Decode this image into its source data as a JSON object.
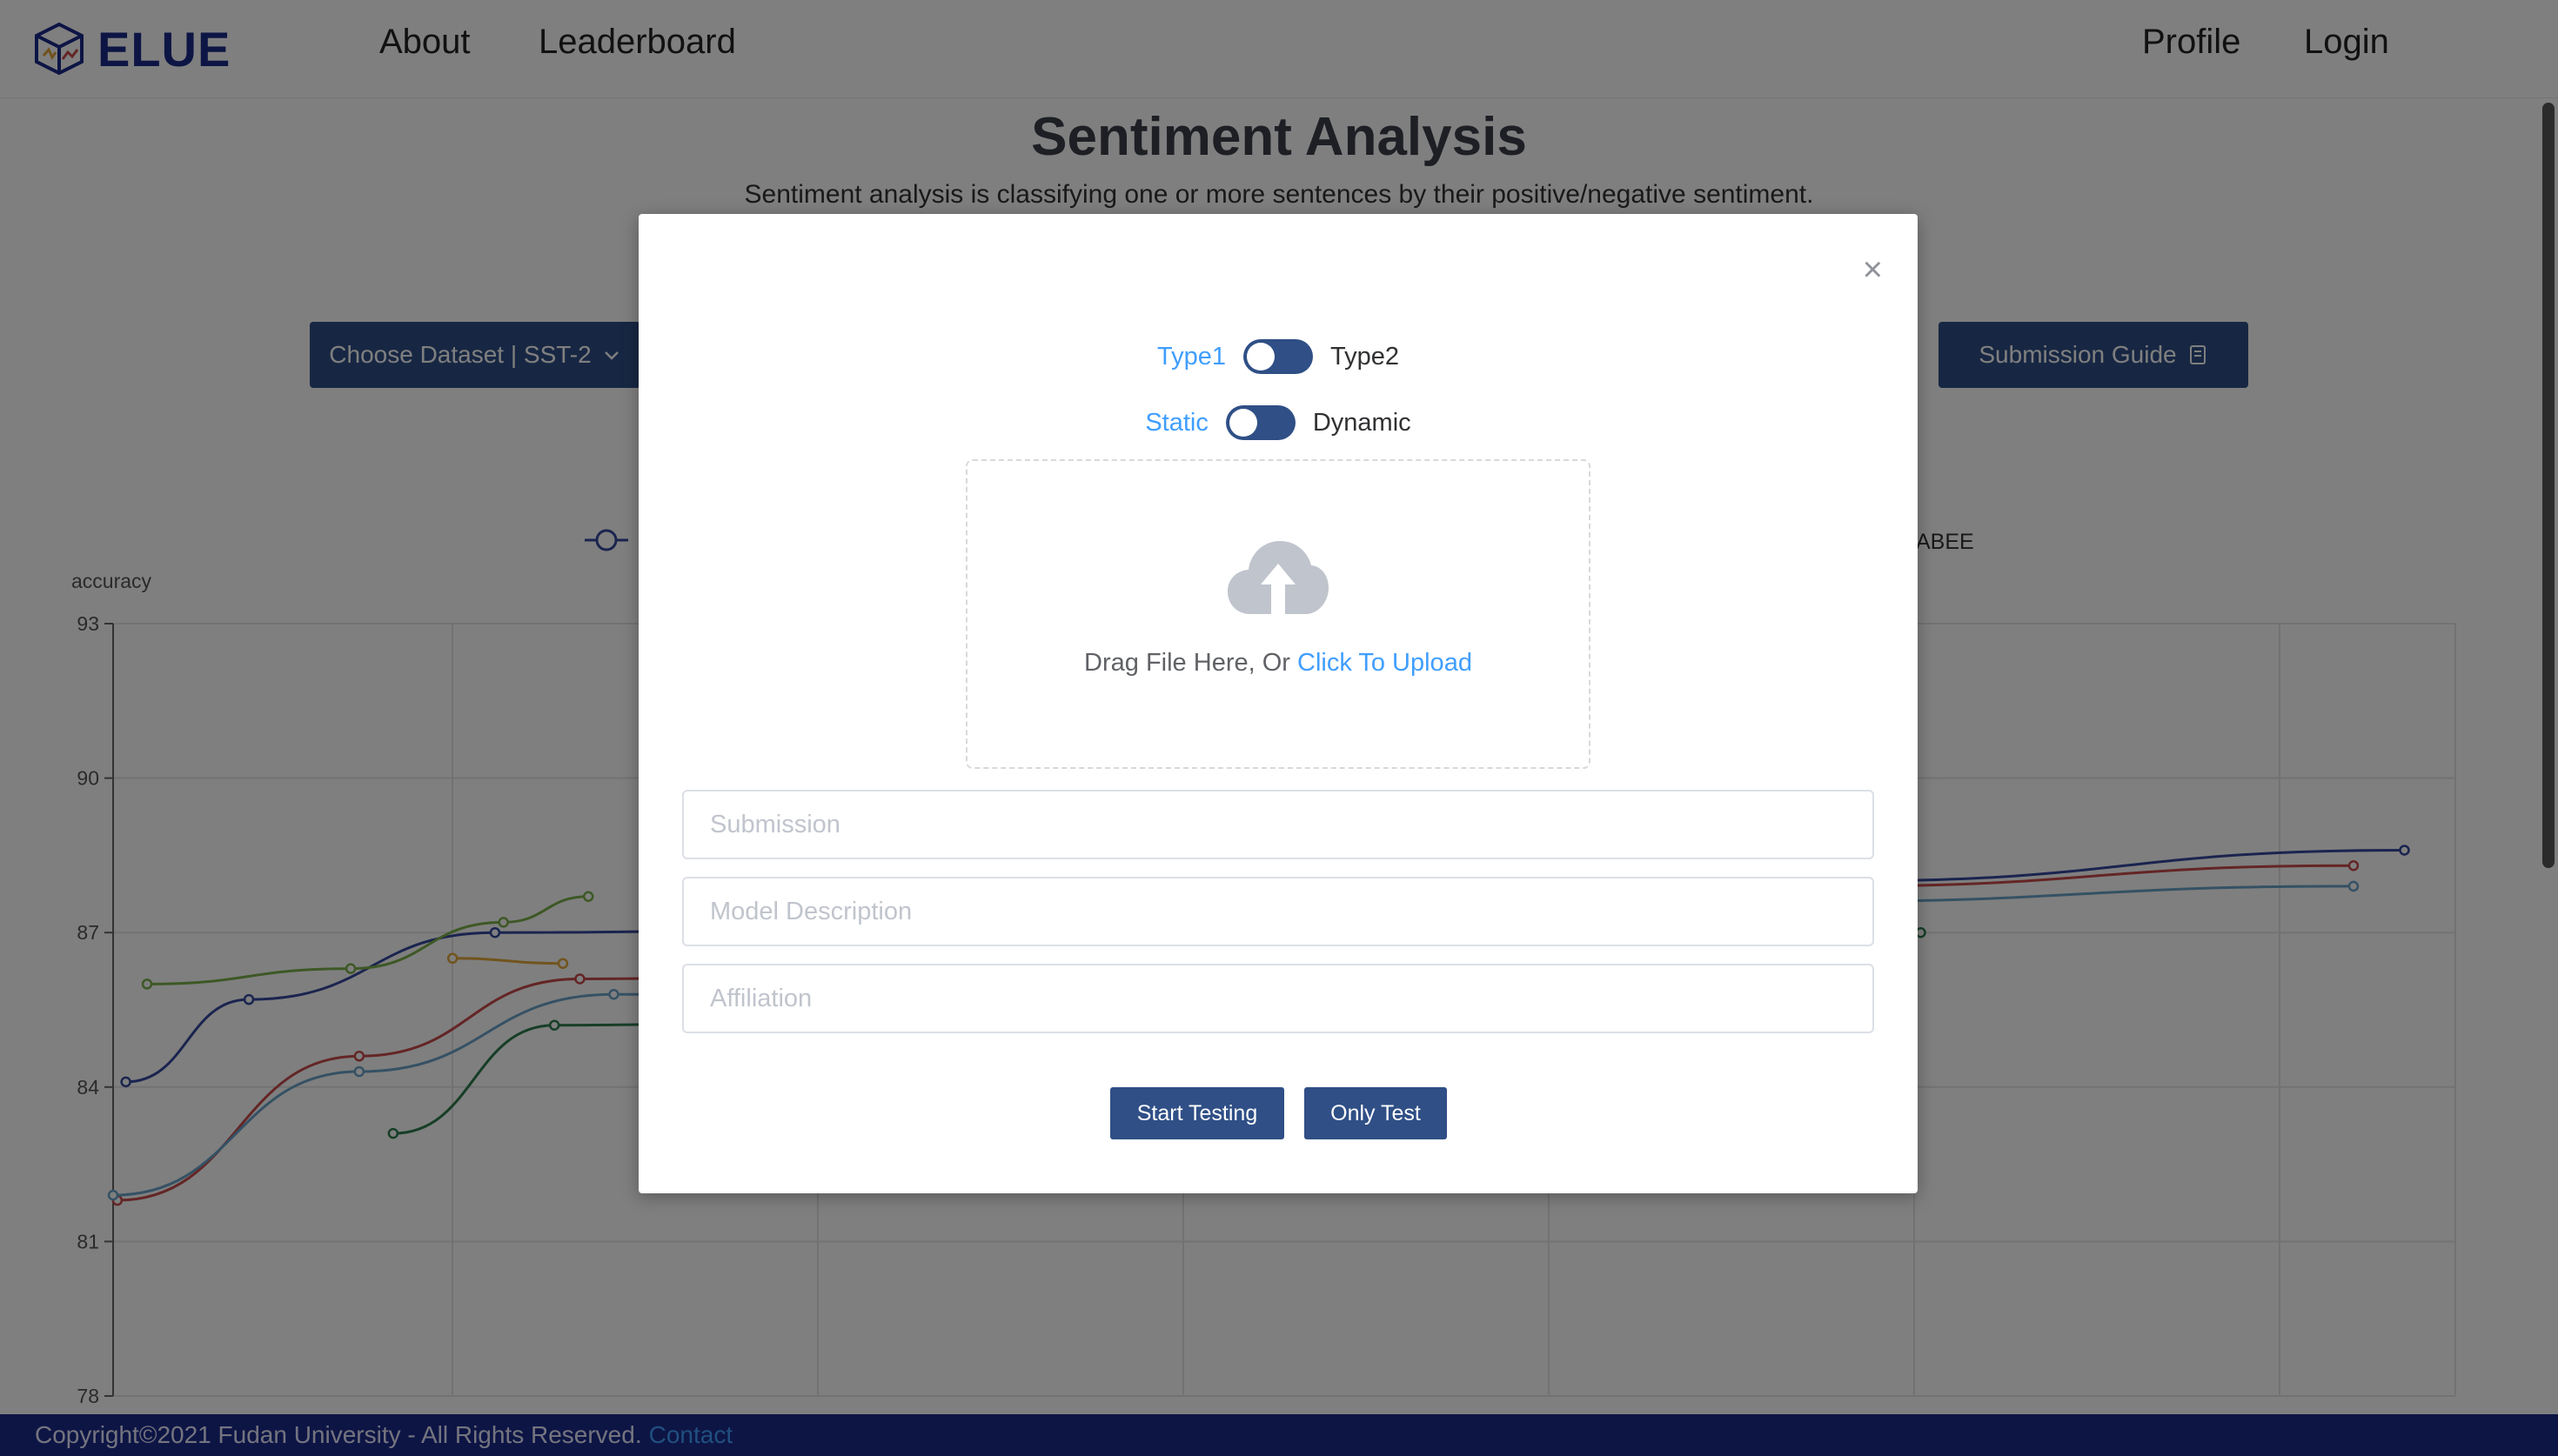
{
  "header": {
    "brand": "ELUE",
    "nav": {
      "about": "About",
      "leaderboard": "Leaderboard"
    },
    "right_nav": {
      "profile": "Profile",
      "login": "Login"
    }
  },
  "page": {
    "title": "Sentiment Analysis",
    "subtitle": "Sentiment analysis is classifying one or more sentences by their positive/negative sentiment.",
    "dataset_button": "Choose Dataset | SST-2",
    "submission_guide_button": "Submission Guide"
  },
  "chart_data": {
    "type": "line",
    "ylabel": "accuracy",
    "ylim": [
      78,
      93
    ],
    "yticks": [
      "93",
      "90",
      "87",
      "84",
      "81",
      "78"
    ],
    "legend_partial": "ABEE",
    "series": [
      {
        "color": "#34489e",
        "points": [
          [
            0.15,
            84.1
          ],
          [
            1.6,
            85.7
          ],
          [
            4.5,
            87.0
          ],
          [
            20.4,
            88.0
          ],
          [
            27.0,
            88.6
          ]
        ]
      },
      {
        "color": "#c94b4b",
        "points": [
          [
            0.05,
            81.8
          ],
          [
            2.9,
            84.6
          ],
          [
            5.5,
            86.1
          ],
          [
            20.3,
            87.9
          ],
          [
            26.4,
            88.3
          ]
        ]
      },
      {
        "color": "#6ba3c9",
        "points": [
          [
            0.0,
            81.9
          ],
          [
            2.9,
            84.3
          ],
          [
            5.9,
            85.8
          ],
          [
            20.0,
            87.6
          ],
          [
            26.4,
            87.9
          ]
        ]
      },
      {
        "color": "#7bb04a",
        "points": [
          [
            0.4,
            86.0
          ],
          [
            2.8,
            86.3
          ],
          [
            4.6,
            87.2
          ],
          [
            5.6,
            87.7
          ]
        ]
      },
      {
        "color": "#e2a83a",
        "points": [
          [
            4.0,
            86.5
          ],
          [
            5.3,
            86.4
          ]
        ]
      },
      {
        "color": "#2e7d4f",
        "points": [
          [
            3.3,
            83.1
          ],
          [
            5.2,
            85.2
          ],
          [
            19.9,
            87.0
          ],
          [
            21.3,
            87.0
          ]
        ]
      }
    ]
  },
  "modal": {
    "type1_label": "Type1",
    "type2_label": "Type2",
    "static_label": "Static",
    "dynamic_label": "Dynamic",
    "upload_text": "Drag File Here, Or ",
    "upload_link": "Click To Upload",
    "submission_placeholder": "Submission",
    "description_placeholder": "Model Description",
    "affiliation_placeholder": "Affiliation",
    "start_testing_button": "Start Testing",
    "only_test_button": "Only Test",
    "close_symbol": "×"
  },
  "footer": {
    "copyright": "Copyright©2021 Fudan University - All Rights Reserved.",
    "contact": "Contact"
  },
  "icons": {
    "logo": "cube-logo-icon",
    "upload": "cloud-upload-icon",
    "close": "close-icon",
    "dropdown": "chevron-down-icon",
    "guide": "guide-icon"
  }
}
